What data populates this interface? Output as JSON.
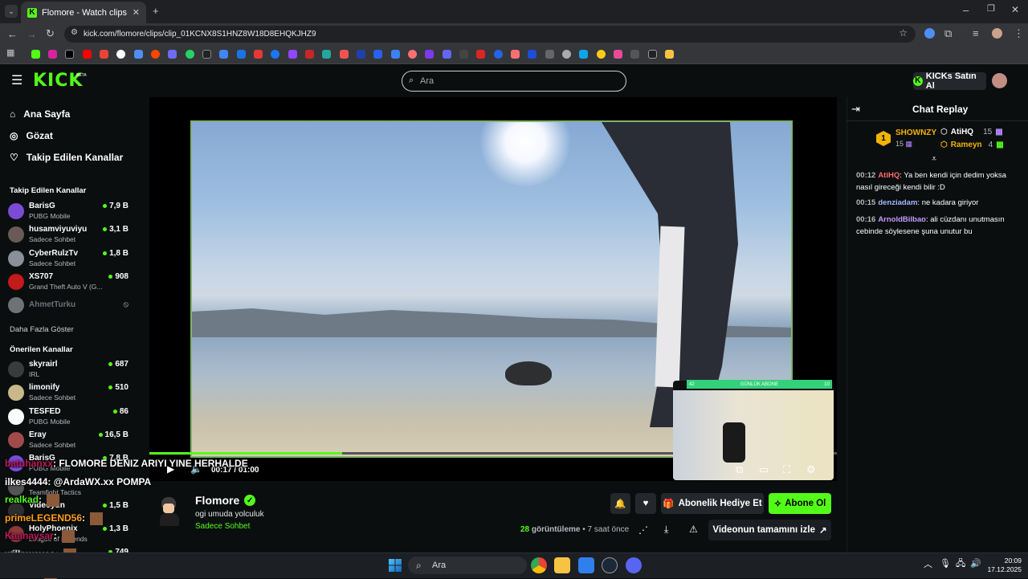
{
  "browser": {
    "tab_title": "Flomore - Watch clips on Kick",
    "url": "kick.com/flomore/clips/clip_01KCNX8S1HNZ8W18D8EHQKJHZ9"
  },
  "header": {
    "logo": "KICK",
    "logo_badge": "BETA",
    "search_placeholder": "Ara",
    "kicks_button": "KICKs Satın Al"
  },
  "sidebar": {
    "nav": [
      {
        "label": "Ana Sayfa",
        "icon": "home-icon"
      },
      {
        "label": "Gözat",
        "icon": "compass-icon"
      },
      {
        "label": "Takip Edilen Kanallar",
        "icon": "heart-icon"
      }
    ],
    "followed_heading": "Takip Edilen Kanallar",
    "followed": [
      {
        "name": "BarisG",
        "category": "PUBG Mobile",
        "viewers": "7,9 B",
        "color": "#7b4bd6"
      },
      {
        "name": "husamviyuviyu",
        "category": "Sadece Sohbet",
        "viewers": "3,1 B",
        "color": "#6a5a55"
      },
      {
        "name": "CyberRulzTv",
        "category": "Sadece Sohbet",
        "viewers": "1,8 B",
        "color": "#8a8f99"
      },
      {
        "name": "XS707",
        "category": "Grand Theft Auto V (G...",
        "viewers": "908",
        "color": "#c41a1a"
      },
      {
        "name": "AhmetTurku",
        "category": "",
        "viewers": "",
        "color": "#6e7176"
      }
    ],
    "show_more": "Daha Fazla Göster",
    "recommended_heading": "Önerilen Kanallar",
    "recommended": [
      {
        "name": "skyrairl",
        "category": "IRL",
        "viewers": "687",
        "color": "#3b3b3b"
      },
      {
        "name": "limonify",
        "category": "Sadece Sohbet",
        "viewers": "510",
        "color": "#c9b98a"
      },
      {
        "name": "TESFED",
        "category": "PUBG Mobile",
        "viewers": "86",
        "color": "#ffffff"
      },
      {
        "name": "Eray",
        "category": "Sadece Sohbet",
        "viewers": "16,5 B",
        "color": "#a04b4b"
      },
      {
        "name": "BarisG",
        "category": "PUBG Mobile",
        "viewers": "7,8 B",
        "color": "#7b4bd6"
      },
      {
        "name": "",
        "category": "Teamfight Tactics",
        "viewers": "",
        "color": "#555"
      },
      {
        "name": "Videoyun",
        "category": "",
        "viewers": "1,5 B",
        "color": "#2e2e2e"
      },
      {
        "name": "HolyPhoenix",
        "category": "League of Legends",
        "viewers": "1,3 B",
        "color": "#8c3a3a"
      },
      {
        "name": "",
        "category": "",
        "viewers": "749",
        "color": "#555"
      }
    ]
  },
  "player": {
    "time_current": "00:17",
    "time_total": "01:00",
    "progress_fraction": 0.28,
    "webcam_label": "GÜNLÜK ABONE",
    "webcam_left": "42",
    "webcam_right": "10"
  },
  "overlay_chat": [
    {
      "user": "batuhanxx",
      "text": ": FLOMORE DENIZ ARIYI YINE HERHALDE",
      "color": "#c2185b"
    },
    {
      "user": "ilkes4444",
      "text": ": @ArdaWX.xx POMPA",
      "color": "#ffffff"
    },
    {
      "user": "realkad",
      "text": ":",
      "color": "#53fc18"
    },
    {
      "user": "primeLEGEND56",
      "text": ":",
      "color": "#ff9f1c"
    },
    {
      "user": "Kaanaysar",
      "text": ":",
      "color": "#c2185b"
    },
    {
      "user": "willowaves",
      "text": ":",
      "color": "#d0d0d0"
    },
    {
      "user": "ZOD20",
      "text": ":",
      "color": "#ffcc00"
    }
  ],
  "clip_info": {
    "streamer": "Flomore",
    "title": "ogi umuda yolculuk",
    "category": "Sadece Sohbet",
    "views_count": "28",
    "views_label": "görüntüleme",
    "age": "7 saat önce",
    "gift_button": "Abonelik Hediye Et",
    "subscribe_button": "Abone Ol",
    "full_video_button": "Videonun tamamını izle"
  },
  "chat": {
    "title": "Chat Replay",
    "leaders": [
      {
        "name": "SHOWNZY",
        "count": "15",
        "color": "#f0b400"
      },
      {
        "name": "AtiHQ",
        "count": "15",
        "color": "#ffffff"
      },
      {
        "name": "Rameyn",
        "count": "4",
        "color": "#f0b400"
      }
    ],
    "rank_badge": "1",
    "messages": [
      {
        "time": "00:12",
        "user": "AtiHQ",
        "text": ": Ya ben kendi için dedim yoksa nasıl gireceği kendi bilir :D",
        "color": "#ff6b6b"
      },
      {
        "time": "00:15",
        "user": "denziadam",
        "text": ": ne kadara giriyor",
        "color": "#a7b5ff"
      },
      {
        "time": "00:16",
        "user": "ArnoldBilbao",
        "text": ": ali cüzdanı unutmasın cebinde söylesene şuna unutur bu",
        "color": "#c49cff"
      }
    ]
  },
  "taskbar": {
    "search_placeholder": "Ara",
    "time": "20:09",
    "date": "17.12.2025"
  },
  "colors": {
    "accent": "#53fc18",
    "bg": "#0b0e0f"
  }
}
